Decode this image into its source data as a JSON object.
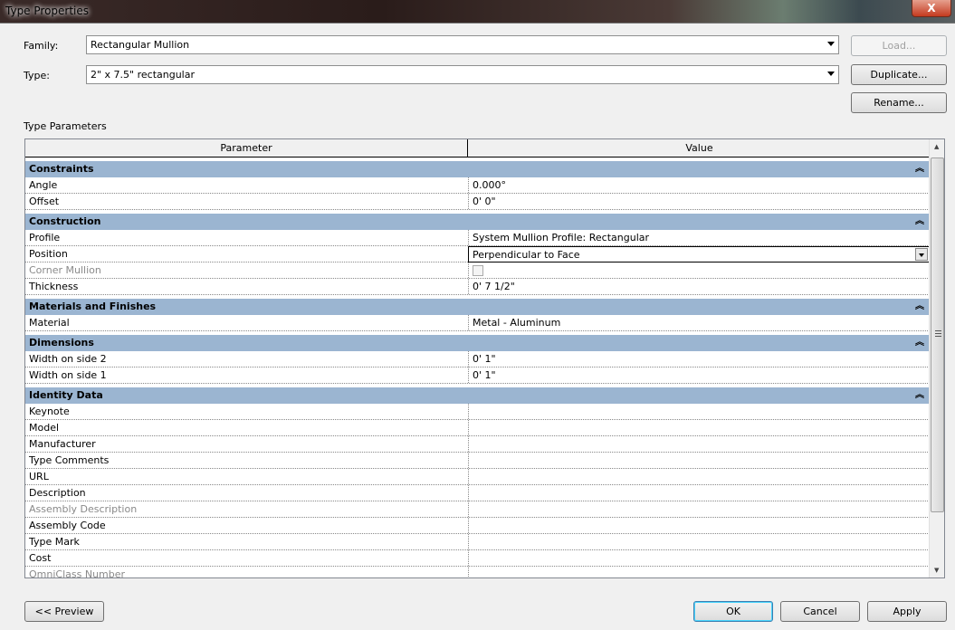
{
  "window": {
    "title": "Type Properties",
    "close_label": "X"
  },
  "family": {
    "label": "Family:",
    "value": "Rectangular Mullion"
  },
  "type": {
    "label": "Type:",
    "value": "2\" x 7.5\" rectangular"
  },
  "buttons": {
    "load": "Load...",
    "duplicate": "Duplicate...",
    "rename": "Rename...",
    "preview": "<< Preview",
    "ok": "OK",
    "cancel": "Cancel",
    "apply": "Apply"
  },
  "type_parameters_label": "Type Parameters",
  "grid": {
    "headers": {
      "parameter": "Parameter",
      "value": "Value"
    },
    "collapse_glyph": "ˆ",
    "sections": [
      {
        "name": "Constraints",
        "rows": [
          {
            "param": "Angle",
            "value": "0.000°"
          },
          {
            "param": "Offset",
            "value": "0'  0\""
          }
        ]
      },
      {
        "name": "Construction",
        "rows": [
          {
            "param": "Profile",
            "value": "System Mullion Profile: Rectangular"
          },
          {
            "param": "Position",
            "value": "Perpendicular to Face",
            "kind": "dropdown"
          },
          {
            "param": "Corner Mullion",
            "value": "",
            "kind": "checkbox",
            "disabled": true
          },
          {
            "param": "Thickness",
            "value": "0'  7 1/2\""
          }
        ]
      },
      {
        "name": "Materials and Finishes",
        "rows": [
          {
            "param": "Material",
            "value": "Metal - Aluminum"
          }
        ]
      },
      {
        "name": "Dimensions",
        "rows": [
          {
            "param": "Width on side 2",
            "value": "0'  1\""
          },
          {
            "param": "Width on side 1",
            "value": "0'  1\""
          }
        ]
      },
      {
        "name": "Identity Data",
        "rows": [
          {
            "param": "Keynote",
            "value": ""
          },
          {
            "param": "Model",
            "value": ""
          },
          {
            "param": "Manufacturer",
            "value": ""
          },
          {
            "param": "Type Comments",
            "value": ""
          },
          {
            "param": "URL",
            "value": ""
          },
          {
            "param": "Description",
            "value": ""
          },
          {
            "param": "Assembly Description",
            "value": "",
            "disabled": true
          },
          {
            "param": "Assembly Code",
            "value": ""
          },
          {
            "param": "Type Mark",
            "value": ""
          },
          {
            "param": "Cost",
            "value": ""
          },
          {
            "param": "OmniClass Number",
            "value": "",
            "disabled": true
          }
        ]
      }
    ]
  }
}
